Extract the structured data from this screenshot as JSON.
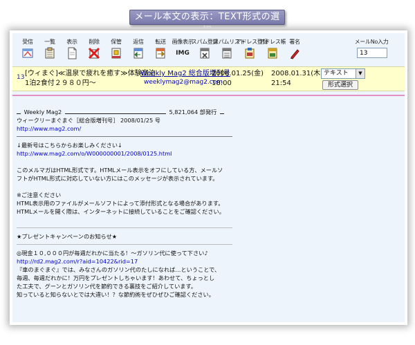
{
  "title": "メール本文の表示：TEXT形式の選択",
  "toolbar": {
    "items": [
      {
        "label": "受信",
        "icon": "receive-icon"
      },
      {
        "label": "一覧",
        "icon": "list-icon"
      },
      {
        "label": "表示",
        "icon": "view-icon"
      },
      {
        "label": "削除",
        "icon": "delete-icon"
      },
      {
        "label": "保管",
        "icon": "archive-icon"
      },
      {
        "label": "返信",
        "icon": "reply-icon"
      },
      {
        "label": "転送",
        "icon": "forward-icon"
      },
      {
        "label": "画像表示",
        "icon": "image-display-icon"
      },
      {
        "label": "スパム登録",
        "icon": "spam-register-icon"
      },
      {
        "label": "スパムリスト",
        "icon": "spam-list-icon"
      },
      {
        "label": "アドレス登録",
        "icon": "address-register-icon"
      },
      {
        "label": "アドレス帳",
        "icon": "address-book-icon"
      },
      {
        "label": "署名",
        "icon": "signature-icon"
      }
    ],
    "img_text": "IMG",
    "mail_no_label": "メールNo入力",
    "mail_no_value": "13"
  },
  "mail": {
    "number": "13",
    "subject_line1": "[ウィまぐ]≪温泉で疲れを癒す≫体験宿泊",
    "subject_line2": "1泊2食付２９８０円〜",
    "sender_name": "Weekly Mag2 総合版増刊号",
    "sender_email": "weeklymag2@mag2.com",
    "sent_date": "2008.01.25(金)",
    "sent_time": "18:00",
    "received_date": "2008.01.31(木)",
    "received_time": "21:54",
    "format_selected": "テキスト",
    "format_button": "形式選択"
  },
  "body": {
    "masthead_name": "Weekly Mag2",
    "masthead_count": "5,821,064 部発行",
    "issue_line": "ウィークリーまぐまぐ［総合版増刊号］ 2008/01/25 号",
    "home_url": "http://www.mag2.com/",
    "latest_line": "↓最新号はこちらからお楽しみください↓",
    "latest_url": "http://www.mag2.com/o/W000000001/2008/0125.html",
    "html_notice_1": "このメルマガはHTML形式です。HTMLメール表示をオフにしている方、メールソ",
    "html_notice_2": "フトがHTML形式に対応していない方にはこのメッセージが表示されています。",
    "caution_title": "※ご注意ください",
    "caution_1": "HTML表示用のファイルがメールソフトによって添付形式となる場合があります。",
    "caution_2": "HTMLメールを開く際は、インターネットに接続していることをご確認ください。",
    "present_title": "★プレゼントキャンペーンのお知らせ★",
    "present_1": "◎現金１０,０００円が毎週だれかに当たる！〜ガソリン代に使って下さい♪",
    "present_url": "http://rd2.mag2.com/r?aid=10422&rid=17",
    "present_2": "『車のまぐまぐ』では、みなさんのガソリン代のたしになれば…ということで、",
    "present_3": "毎週、毎週だれかに！万円をプレゼントしちゃいます！あわせて、ちょっとし",
    "present_4": "た工夫で、グーンとガソリン代を節約できる裏技をご紹介しています。",
    "present_5": "知っていると知らないとでは大違い！？な節約術をぜひぜひご確認ください。"
  }
}
